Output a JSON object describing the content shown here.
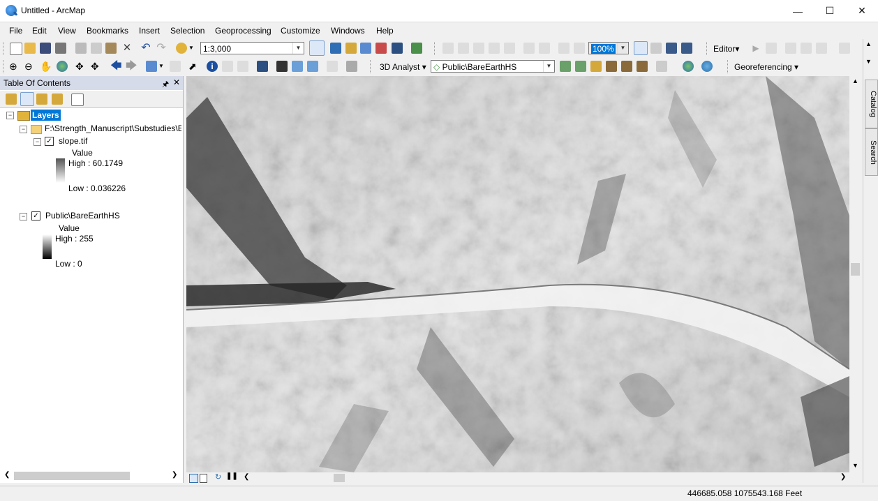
{
  "window": {
    "title": "Untitled - ArcMap"
  },
  "menu": [
    "File",
    "Edit",
    "View",
    "Bookmarks",
    "Insert",
    "Selection",
    "Geoprocessing",
    "Customize",
    "Windows",
    "Help"
  ],
  "standard_toolbar": {
    "scale": "1:3,000",
    "zoom_value": "100%",
    "editor_label": "Editor▾"
  },
  "tools_toolbar": {
    "analyst_label": "3D Analyst ▾",
    "layer_dropdown": "Public\\BareEarthHS",
    "georef_label": "Georeferencing ▾"
  },
  "toc": {
    "title": "Table Of Contents",
    "root": "Layers",
    "folder": "F:\\Strength_Manuscript\\Substudies\\E",
    "layers": [
      {
        "name": "slope.tif",
        "field": "Value",
        "high": "High : 60.1749",
        "low": "Low : 0.036226"
      },
      {
        "name": "Public\\BareEarthHS",
        "field": "Value",
        "high": "High : 255",
        "low": "Low : 0"
      }
    ]
  },
  "dock": {
    "catalog": "Catalog",
    "search": "Search"
  },
  "status": {
    "coordinates": "446685.058  1075543.168 Feet"
  },
  "colors": {
    "toc_header": "#d6dbe9",
    "selection": "#0078d7"
  }
}
